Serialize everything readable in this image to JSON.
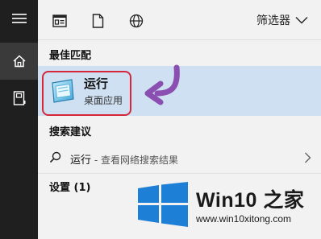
{
  "rail": {
    "items": [
      {
        "icon": "hamburger-menu-icon"
      },
      {
        "icon": "home-icon",
        "active": true
      },
      {
        "icon": "documents-icon"
      }
    ]
  },
  "topbar": {
    "icons": [
      "apps-icon",
      "document-icon",
      "web-icon"
    ],
    "filter_label": "筛选器"
  },
  "best_match": {
    "title": "最佳匹配",
    "app_name": "运行",
    "app_type": "桌面应用",
    "icon": "run-dialog-icon",
    "highlight_color": "#d6263a",
    "arrow_color": "#8a4fb0"
  },
  "suggestions": {
    "title": "搜索建议",
    "item_term": "运行",
    "item_hint": " - 查看网络搜索结果"
  },
  "settings": {
    "title": "设置 (1)"
  },
  "watermark": {
    "brand": "Win10 之家",
    "url": "www.win10xitong.com"
  },
  "colors": {
    "rail": "#1f1f1f",
    "panel": "#f2f2f2",
    "selected": "#cfe0f3",
    "windows_blue": "#1e7fd6"
  }
}
